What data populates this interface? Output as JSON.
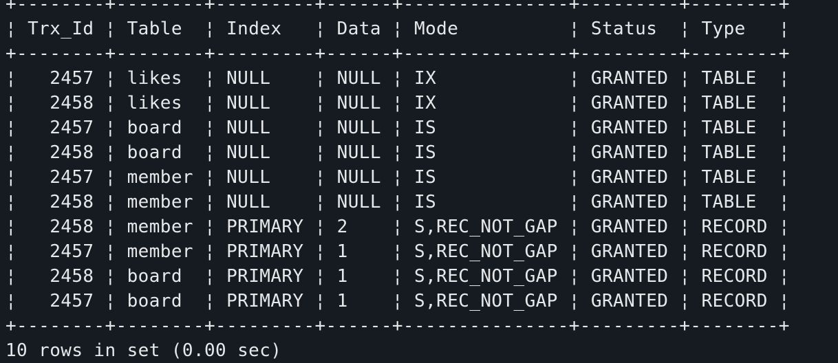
{
  "table": {
    "columns": [
      "Trx_Id",
      "Table",
      "Index",
      "Data",
      "Mode",
      "Status",
      "Type"
    ],
    "rows": [
      [
        "2457",
        "likes",
        "NULL",
        "NULL",
        "IX",
        "GRANTED",
        "TABLE"
      ],
      [
        "2458",
        "likes",
        "NULL",
        "NULL",
        "IX",
        "GRANTED",
        "TABLE"
      ],
      [
        "2457",
        "board",
        "NULL",
        "NULL",
        "IS",
        "GRANTED",
        "TABLE"
      ],
      [
        "2458",
        "board",
        "NULL",
        "NULL",
        "IS",
        "GRANTED",
        "TABLE"
      ],
      [
        "2457",
        "member",
        "NULL",
        "NULL",
        "IS",
        "GRANTED",
        "TABLE"
      ],
      [
        "2458",
        "member",
        "NULL",
        "NULL",
        "IS",
        "GRANTED",
        "TABLE"
      ],
      [
        "2458",
        "member",
        "PRIMARY",
        "2",
        "S,REC_NOT_GAP",
        "GRANTED",
        "RECORD"
      ],
      [
        "2457",
        "member",
        "PRIMARY",
        "1",
        "S,REC_NOT_GAP",
        "GRANTED",
        "RECORD"
      ],
      [
        "2458",
        "board",
        "PRIMARY",
        "1",
        "S,REC_NOT_GAP",
        "GRANTED",
        "RECORD"
      ],
      [
        "2457",
        "board",
        "PRIMARY",
        "1",
        "S,REC_NOT_GAP",
        "GRANTED",
        "RECORD"
      ]
    ],
    "footer": "10 rows in set (0.00 sec)"
  },
  "colors": {
    "background": "#161b22",
    "text": "#e6e8ea"
  }
}
